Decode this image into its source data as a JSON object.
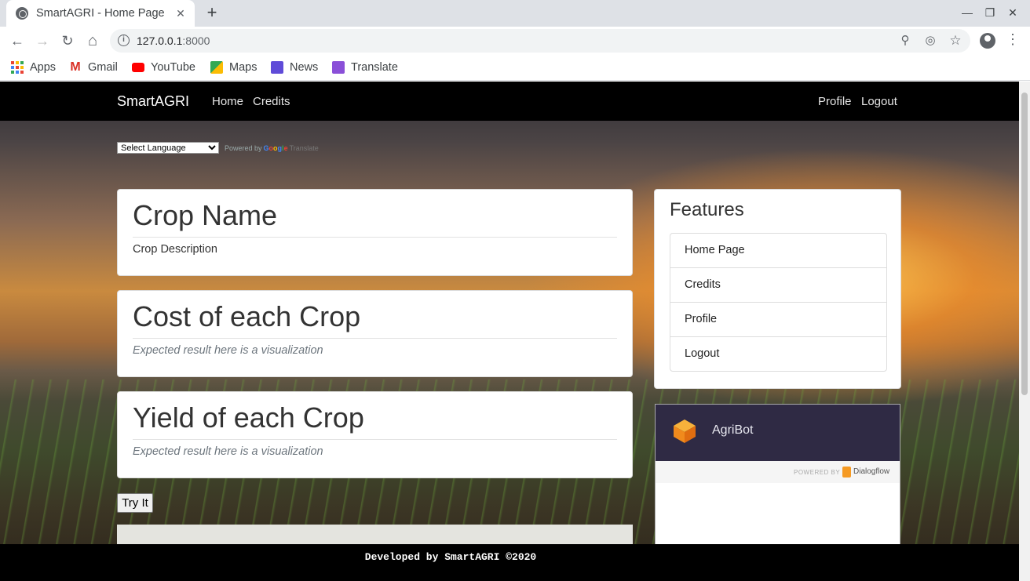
{
  "browser": {
    "tab_title": "SmartAGRI - Home Page",
    "tab_close": "✕",
    "new_tab": "+",
    "minimize": "—",
    "restore": "❐",
    "close_window": "✕",
    "url_host": "127.0.0.1",
    "url_port": ":8000",
    "back": "←",
    "forward": "→",
    "reload": "↻",
    "home": "⌂",
    "zoom_icon": "⚲",
    "eye_icon": "◎",
    "star_icon": "☆",
    "menu_icon": "⋮",
    "bookmarks": [
      {
        "label": "Apps",
        "icon": "apps-grid-icon"
      },
      {
        "label": "Gmail",
        "icon": "gmail-icon",
        "color": "#d93025"
      },
      {
        "label": "YouTube",
        "icon": "youtube-icon",
        "color": "#ff0000"
      },
      {
        "label": "Maps",
        "icon": "maps-icon",
        "color": "#34a853"
      },
      {
        "label": "News",
        "icon": "news-icon",
        "color": "#5f4bd8"
      },
      {
        "label": "Translate",
        "icon": "translate-icon",
        "color": "#8a4fd8"
      }
    ]
  },
  "navbar": {
    "brand": "SmartAGRI",
    "links": [
      "Home",
      "Credits"
    ],
    "right_links": [
      "Profile",
      "Logout"
    ]
  },
  "translate": {
    "select_label": "Select Language",
    "powered_by": "Powered by",
    "google": "Google",
    "translate": "Translate"
  },
  "cards": [
    {
      "title": "Crop Name",
      "text": "Crop Description"
    },
    {
      "title": "Cost of each Crop",
      "text": "Expected result here is a visualization"
    },
    {
      "title": "Yield of each Crop",
      "text": "Expected result here is a visualization"
    }
  ],
  "try_button": "Try It",
  "features": {
    "title": "Features",
    "items": [
      "Home Page",
      "Credits",
      "Profile",
      "Logout"
    ]
  },
  "chatbot": {
    "title": "AgriBot",
    "powered_by": "POWERED BY",
    "provider": "Dialogflow"
  },
  "footer": "Developed by SmartAGRI ©2020",
  "colors": {
    "navbar": "#000000",
    "bot_header": "#2f2a44",
    "dialogflow_orange": "#f59a23"
  }
}
